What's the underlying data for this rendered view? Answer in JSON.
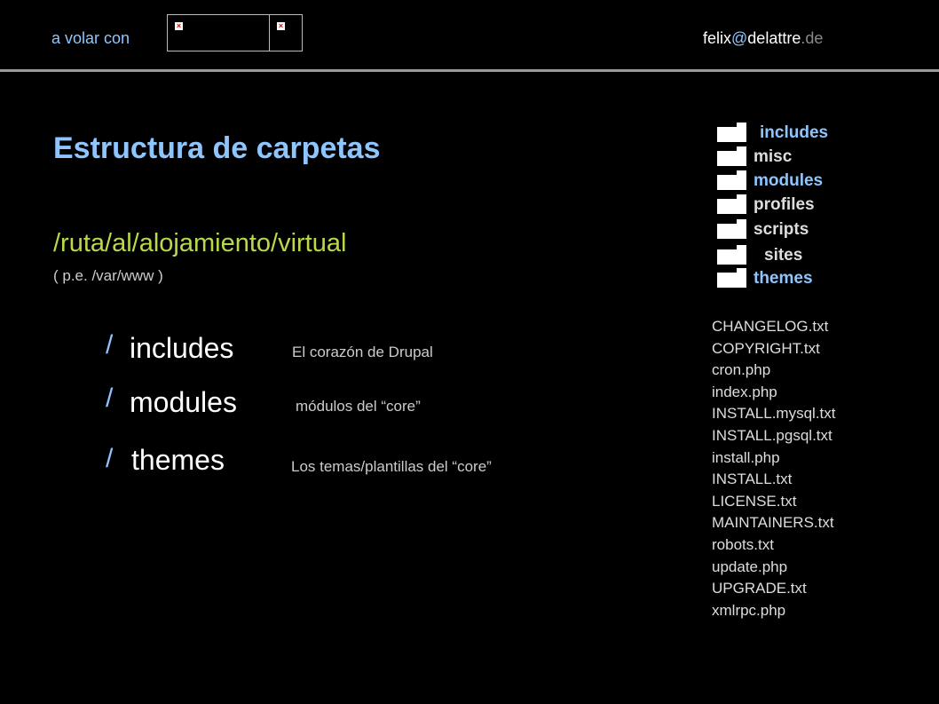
{
  "header": {
    "left_text": "a volar con",
    "email": {
      "user": "felix",
      "at": "@",
      "domain": "delattre",
      "tld": ".de"
    },
    "broken_images": [
      "broken-image-icon",
      "broken-image-icon"
    ]
  },
  "slide": {
    "title": "Estructura de carpetas",
    "path": "/ruta/al/alojamiento/virtual",
    "path_example": "( p.e. /var/www )",
    "folders": [
      {
        "slash": "/",
        "name": "includes",
        "description": "El corazón de Drupal"
      },
      {
        "slash": "/",
        "name": "modules",
        "description": "módulos del “core”"
      },
      {
        "slash": "/",
        "name": "themes",
        "description": "Los temas/plantillas del “core”"
      }
    ]
  },
  "tree": {
    "folders": [
      {
        "label": "includes",
        "highlight": true
      },
      {
        "label": "misc",
        "highlight": false
      },
      {
        "label": "modules",
        "highlight": true
      },
      {
        "label": "profiles",
        "highlight": false
      },
      {
        "label": "scripts",
        "highlight": false
      },
      {
        "label": "sites",
        "highlight": false
      },
      {
        "label": "themes",
        "highlight": true
      }
    ],
    "files": [
      "CHANGELOG.txt",
      "COPYRIGHT.txt",
      "cron.php",
      "index.php",
      "INSTALL.mysql.txt",
      "INSTALL.pgsql.txt",
      "install.php",
      "INSTALL.txt",
      "LICENSE.txt",
      "MAINTAINERS.txt",
      "robots.txt",
      "update.php",
      "UPGRADE.txt",
      "xmlrpc.php"
    ]
  },
  "colors": {
    "accent_blue": "#8ec5ff",
    "accent_green": "#b7d94a",
    "background": "#000000"
  }
}
